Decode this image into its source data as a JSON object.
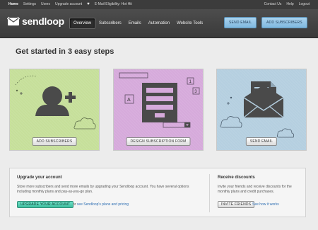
{
  "topbar": {
    "items": [
      "Home",
      "Settings",
      "Users",
      "Upgrade account"
    ],
    "heart_text": "E-Mail Eligibility: Hot Hit",
    "right_items": [
      "Contact Us",
      "Help",
      "Logout"
    ]
  },
  "header": {
    "logo_text": "sendloop",
    "nav": [
      "Overview",
      "Subscribers",
      "Emails",
      "Automation",
      "Website Tools"
    ],
    "active_nav": "Overview",
    "send_email_label": "SEND EMAIL",
    "add_subscribers_label": "ADD SUBSCRIBERS"
  },
  "main": {
    "title": "Get started in 3 easy steps",
    "cards": [
      {
        "button": "ADD SUBSCRIBERS",
        "color": "#c6df9a"
      },
      {
        "button": "DESIGN SUBSCRIPTION FORM",
        "color": "#d6aadb"
      },
      {
        "button": "SEND EMAIL",
        "color": "#b5cfe0"
      }
    ]
  },
  "upgrade": {
    "title": "Upgrade your account",
    "text": "Store more subscribers and send more emails by upgrading your Sendloop account. You have several options including monthly plans and pay-as-you-go plan.",
    "button": "UPGRADE YOUR ACCOUNT",
    "or_prefix": "or",
    "link": "see Sendloop's plans and pricing"
  },
  "discounts": {
    "title": "Receive discounts",
    "text": "Invite your friends and receive discounts for the monthly plans and credit purchases.",
    "button": "INVITE FRIENDS",
    "link": "See how it works"
  },
  "colors": {
    "accent_blue": "#7fb8df",
    "upgrade_green": "#3fbf9f",
    "header_dark": "#3a3a3a"
  },
  "icons": [
    "heart-icon",
    "mail-logo-icon",
    "add-user-icon",
    "form-icon",
    "envelope-icon",
    "cloud-icon"
  ]
}
